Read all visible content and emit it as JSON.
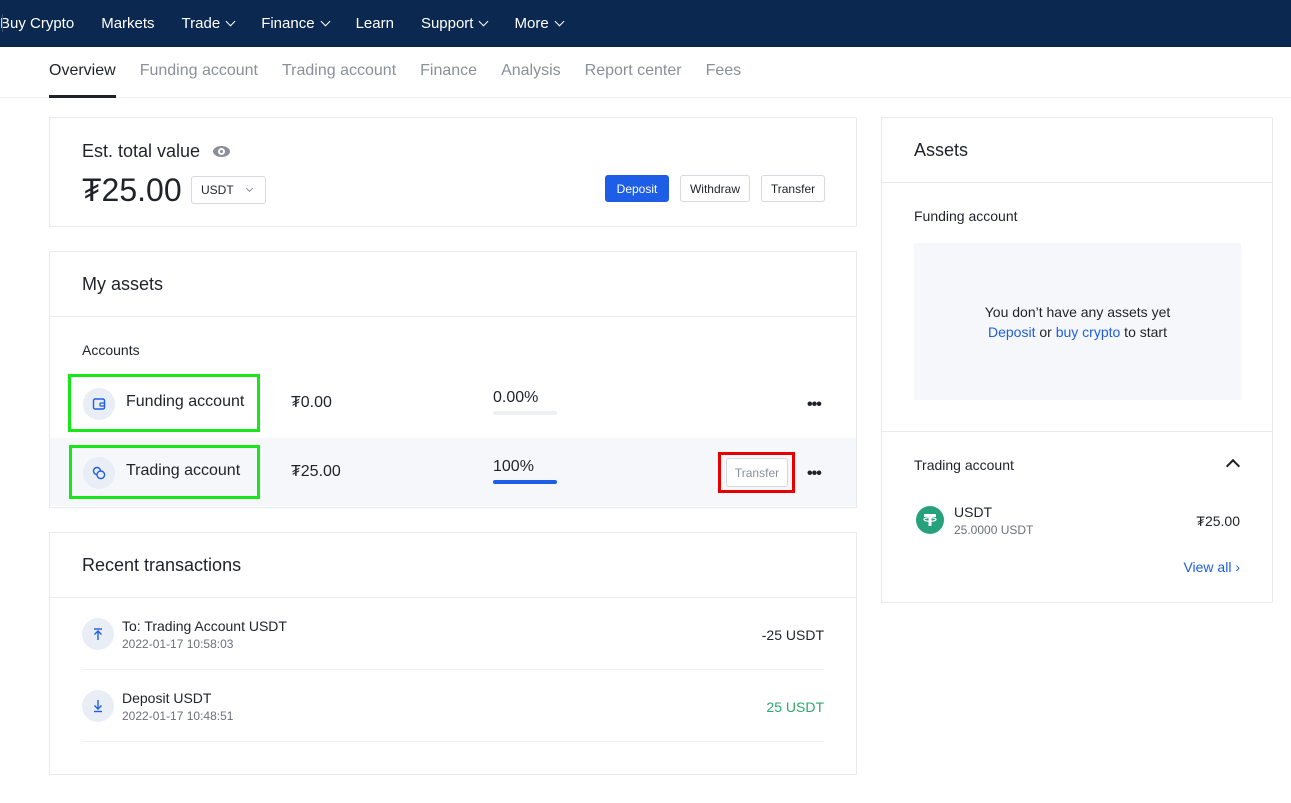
{
  "topnav": {
    "items": [
      {
        "label": "Buy Crypto",
        "dropdown": false
      },
      {
        "label": "Markets",
        "dropdown": false
      },
      {
        "label": "Trade",
        "dropdown": true
      },
      {
        "label": "Finance",
        "dropdown": true
      },
      {
        "label": "Learn",
        "dropdown": false
      },
      {
        "label": "Support",
        "dropdown": true
      },
      {
        "label": "More",
        "dropdown": true
      }
    ]
  },
  "subnav": {
    "tabs": [
      {
        "label": "Overview",
        "active": true
      },
      {
        "label": "Funding account",
        "active": false
      },
      {
        "label": "Trading account",
        "active": false
      },
      {
        "label": "Finance",
        "active": false
      },
      {
        "label": "Analysis",
        "active": false
      },
      {
        "label": "Report center",
        "active": false
      },
      {
        "label": "Fees",
        "active": false
      }
    ]
  },
  "total": {
    "label": "Est. total value",
    "value": "₮25.00",
    "currency": "USDT",
    "buttons": {
      "deposit": "Deposit",
      "withdraw": "Withdraw",
      "transfer": "Transfer"
    }
  },
  "my_assets": {
    "title": "My assets",
    "accounts_label": "Accounts",
    "accounts": [
      {
        "name": "Funding account",
        "amount": "₮0.00",
        "percent": "0.00%",
        "share": 0,
        "icon": "wallet-icon"
      },
      {
        "name": "Trading account",
        "amount": "₮25.00",
        "percent": "100%",
        "share": 100,
        "icon": "coins-icon",
        "transfer_label": "Transfer"
      }
    ]
  },
  "recent": {
    "title": "Recent transactions",
    "items": [
      {
        "title": "To: Trading Account USDT",
        "time": "2022-01-17 10:58:03",
        "amount": "-25 USDT",
        "icon": "arrow-up-icon",
        "positive": false
      },
      {
        "title": "Deposit USDT",
        "time": "2022-01-17 10:48:51",
        "amount": "25 USDT",
        "icon": "arrow-down-icon",
        "positive": true
      }
    ]
  },
  "assets_panel": {
    "title": "Assets",
    "funding_label": "Funding account",
    "empty_line1": "You don’t have any assets yet",
    "empty_deposit": "Deposit",
    "empty_or": " or ",
    "empty_buy": "buy crypto",
    "empty_tail": " to start",
    "trading_label": "Trading account",
    "coin": {
      "name": "USDT",
      "sub": "25.0000 USDT",
      "value": "₮25.00"
    },
    "view_all": "View all ›"
  },
  "colors": {
    "accent": "#1e5ee6",
    "nav_bg": "#0b2850",
    "positive": "#2ea86a",
    "usdt": "#26a17b"
  }
}
